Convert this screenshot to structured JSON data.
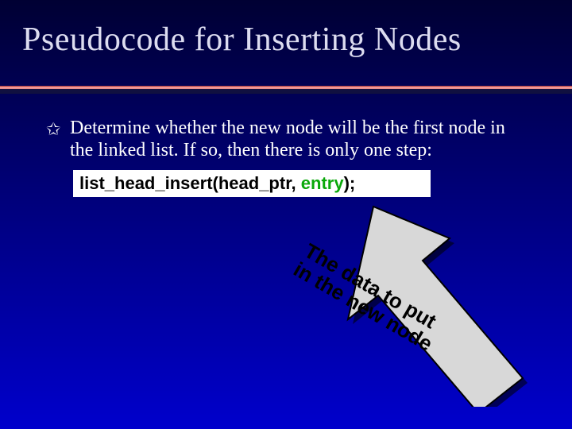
{
  "title": "Pseudocode for Inserting Nodes",
  "bullet": {
    "marker": "✩",
    "line1": "Determine whether the new node will be the first node in",
    "line2": "the linked list.  If so, then there is only one step:"
  },
  "code": {
    "part1": "list_head_insert(head_ptr, ",
    "part2_green": "entry",
    "part3": ");"
  },
  "annotation": {
    "line1": "The data to put",
    "line2": "in the new node"
  }
}
